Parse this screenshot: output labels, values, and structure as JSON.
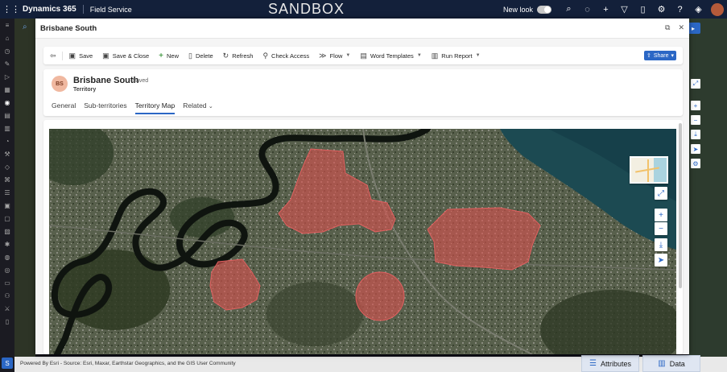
{
  "topbar": {
    "app_name": "Dynamics 365",
    "area_name": "Field Service",
    "environment_banner": "SANDBOX",
    "new_look_label": "New look",
    "icons": [
      "search-icon",
      "lightbulb-icon",
      "plus-icon",
      "filter-icon",
      "notification-icon",
      "settings-icon",
      "help-icon",
      "copilot-icon"
    ]
  },
  "dialog": {
    "title": "Brisbane South"
  },
  "command_bar": {
    "save": "Save",
    "save_close": "Save & Close",
    "new": "New",
    "delete": "Delete",
    "refresh": "Refresh",
    "check_access": "Check Access",
    "flow": "Flow",
    "word_templates": "Word Templates",
    "run_report": "Run Report",
    "share": "Share"
  },
  "record": {
    "initials": "BS",
    "name": "Brisbane South",
    "status": "- Saved",
    "entity": "Territory"
  },
  "tabs": [
    {
      "label": "General"
    },
    {
      "label": "Sub-territories"
    },
    {
      "label": "Territory Map"
    },
    {
      "label": "Related"
    }
  ],
  "map": {
    "attribution": "Powered By Esri - Source: Esri, Maxar, Earthstar Geographics, and the GIS User Community",
    "territory_fill": "#d9534f",
    "river_color": "#101410"
  },
  "bottom_tabs": {
    "attributes": "Attributes",
    "data": "Data"
  },
  "colors": {
    "accent": "#2b67c5",
    "topbar": "#13203a"
  }
}
